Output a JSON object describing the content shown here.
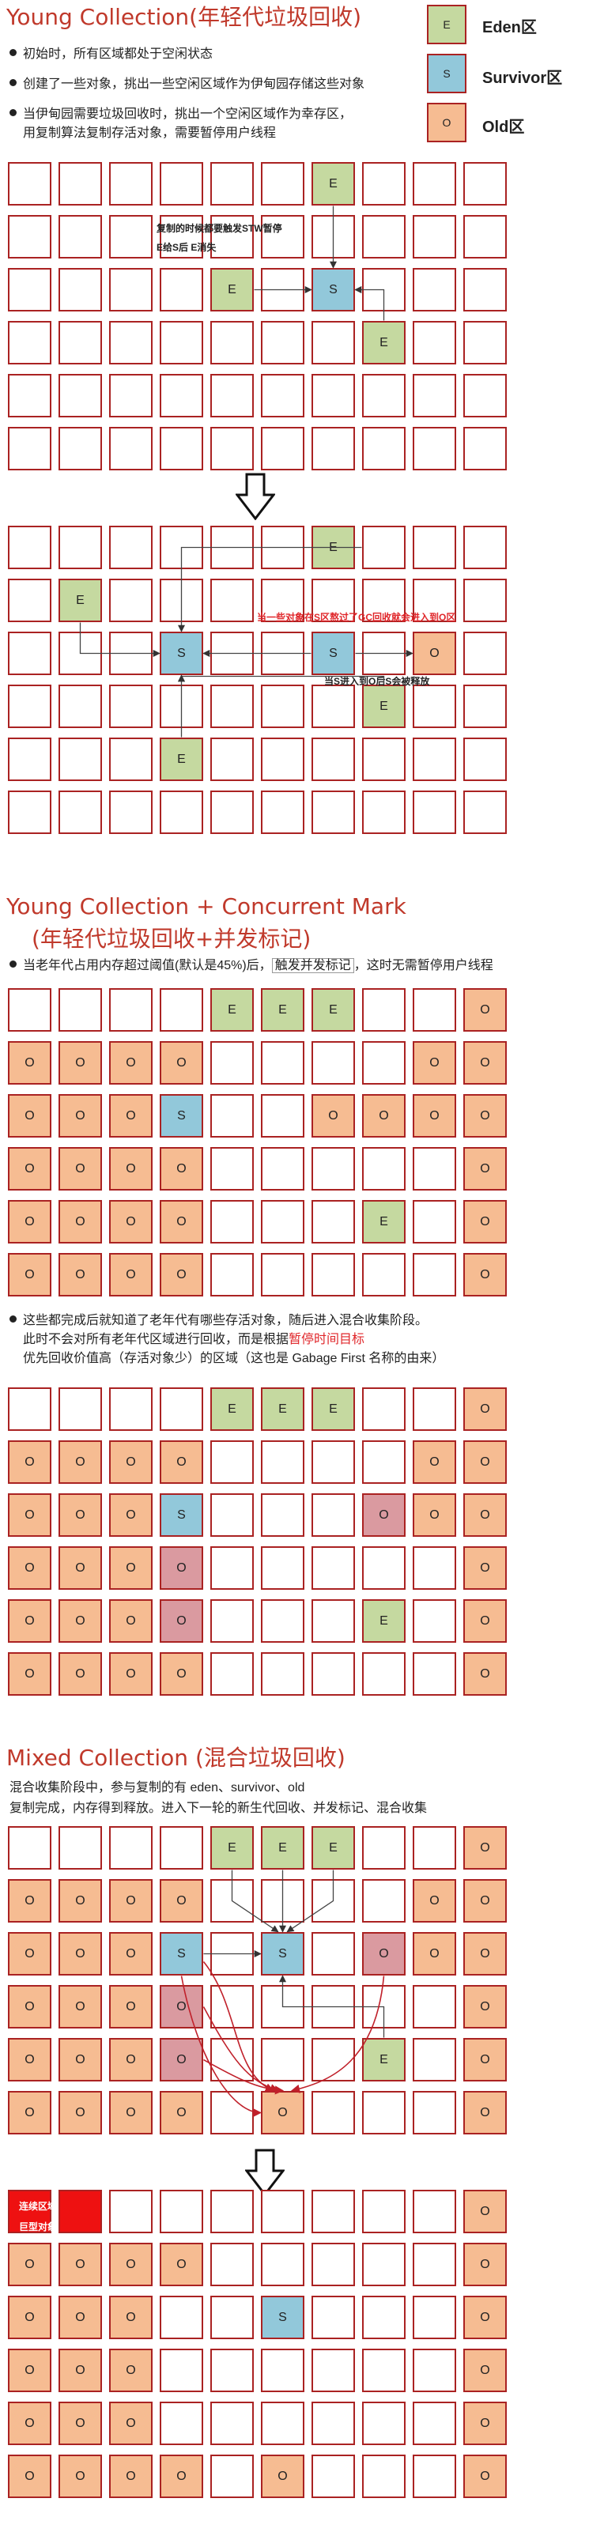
{
  "legend": {
    "eden_short": "E",
    "eden_label": "Eden区",
    "survivor_short": "S",
    "survivor_label": "Survivor区",
    "old_short": "O",
    "old_label": "Old区"
  },
  "section1": {
    "title": "Young Collection(年轻代垃圾回收)",
    "bullets": [
      "初始时，所有区域都处于空闲状态",
      "创建了一些对象，挑出一些空闲区域作为伊甸园存储这些对象",
      "当伊甸园需要垃圾回收时，挑出一个空闲区域作为幸存区，",
      "用复制算法复制存活对象，需要暂停用户线程"
    ],
    "note1a": "复制的时候都要触发STW暂停",
    "note1b": "E给S后 E消失",
    "note2a": "当一些对象在S区熬过了GC回收就会进入到O区",
    "note2b": "当S进入到O后S会被释放"
  },
  "section2": {
    "title1": "Young Collection + Concurrent Mark",
    "title2": "(年轻代垃圾回收+并发标记)",
    "bullet_pre": "当老年代占用内存超过阈值(默认是45%)后，",
    "bullet_box": "触发并发标记",
    "bullet_post": "，这时无需暂停用户线程",
    "p2a": "这些都完成后就知道了老年代有哪些存活对象，随后进入混合收集阶段。",
    "p2b_pre": "此时不会对所有老年代区域进行回收，而是根据",
    "p2b_red": "暂停时间目标",
    "p2c": "优先回收价值高（存活对象少）的区域（这也是 Gabage First 名称的由来）"
  },
  "section3": {
    "title": "Mixed  Collection (混合垃圾回收)",
    "p1": "混合收集阶段中，参与复制的有 eden、survivor、old",
    "p2": "复制完成，内存得到释放。进入下一轮的新生代回收、并发标记、混合收集",
    "humongous_a": "连续区域",
    "humongous_b": "巨型对象"
  },
  "grids": [
    [
      "..........",
      "..........",
      "..........",
      "..........",
      "..........",
      ".........."
    ],
    [
      "......E...",
      "..........",
      "....E.S...",
      ".......E..",
      "..........",
      ".........."
    ],
    [
      "......E...",
      ".E........",
      "...S..S.O.",
      ".......E..",
      "...E......",
      ".........."
    ],
    [
      "....EEE..O",
      "OOOO....OO",
      "OOOS..OOOO",
      "OOOO.....O",
      "OOOO...E.O",
      "OOOO.....O"
    ],
    [
      "....EEE..O",
      "OOOO....OO",
      "OOOS...ROO",
      "OOOR.....O",
      "OOOR...E.O",
      "OOOO.....O"
    ],
    [
      "....EEE..O",
      "OOOO....OO",
      "OOOS.S.ROO",
      "OOOR.....O",
      "OOOR...E.O",
      "OOOO.O...O"
    ],
    [
      "HH.......O",
      "OOOO.....O",
      "OOO..S...O",
      "OOO......O",
      "OOO......O",
      "OOOO.O...O"
    ]
  ],
  "cell_text": {
    "E": "E",
    "S": "S",
    "O": "O",
    "R": "O",
    "H": "",
    ".": ""
  }
}
